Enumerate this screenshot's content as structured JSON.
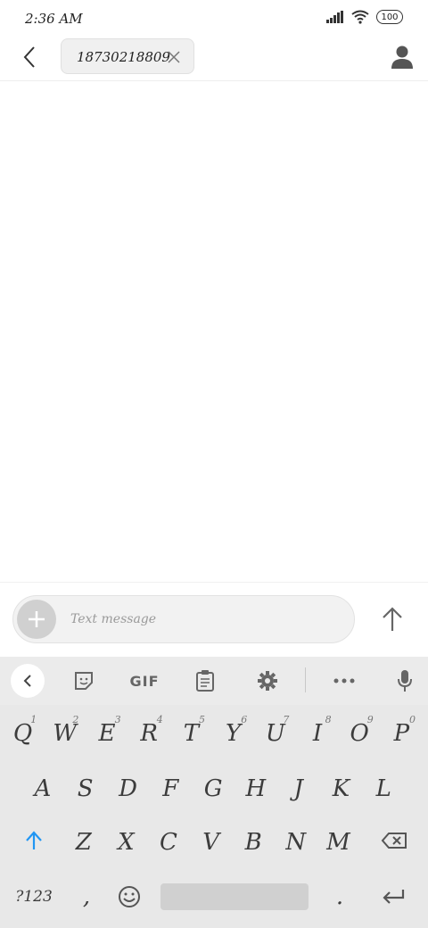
{
  "status": {
    "time": "2:36 AM",
    "battery": "100"
  },
  "header": {
    "recipient": "18730218809"
  },
  "compose": {
    "placeholder": "Text message"
  },
  "keyboard": {
    "toolbar": {
      "gif_label": "GIF"
    },
    "row1": [
      {
        "label": "Q",
        "hint": "1"
      },
      {
        "label": "W",
        "hint": "2"
      },
      {
        "label": "E",
        "hint": "3"
      },
      {
        "label": "R",
        "hint": "4"
      },
      {
        "label": "T",
        "hint": "5"
      },
      {
        "label": "Y",
        "hint": "6"
      },
      {
        "label": "U",
        "hint": "7"
      },
      {
        "label": "I",
        "hint": "8"
      },
      {
        "label": "O",
        "hint": "9"
      },
      {
        "label": "P",
        "hint": "0"
      }
    ],
    "row2": [
      "A",
      "S",
      "D",
      "F",
      "G",
      "H",
      "J",
      "K",
      "L"
    ],
    "row3": [
      "Z",
      "X",
      "C",
      "V",
      "B",
      "N",
      "M"
    ],
    "bottom": {
      "symbols": "?123",
      "comma": ",",
      "period": "."
    }
  },
  "colors": {
    "accent": "#2196f3",
    "keyboard_bg": "#e8e8e8",
    "key_text": "#3c3c3c"
  }
}
